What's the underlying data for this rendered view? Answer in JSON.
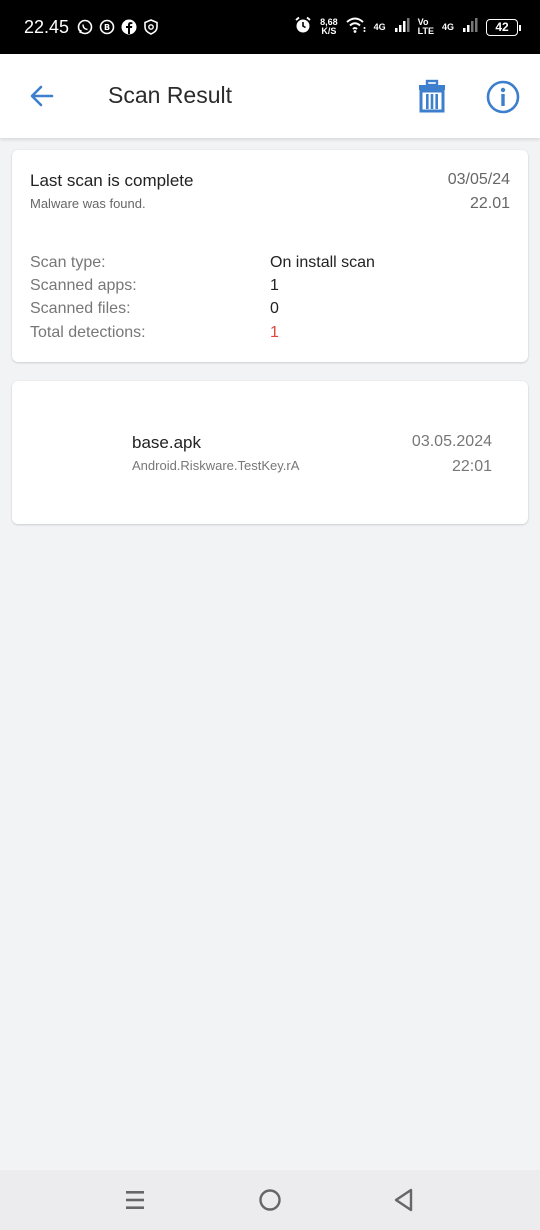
{
  "status_bar": {
    "time": "22.45",
    "net_speed": "8,68",
    "net_speed_unit": "K/S",
    "network_1": "4G",
    "volte": "Vo",
    "volte_sub": "LTE",
    "network_2": "4G",
    "battery": "42"
  },
  "app_bar": {
    "title": "Scan Result",
    "accent_color": "#3d7fcc"
  },
  "summary": {
    "title": "Last scan is complete",
    "subtitle": "Malware was found.",
    "date": "03/05/24",
    "time": "22.01",
    "stats": [
      {
        "label": "Scan type:",
        "value": "On install scan"
      },
      {
        "label": "Scanned apps:",
        "value": "1"
      },
      {
        "label": "Scanned files:",
        "value": "0"
      },
      {
        "label": "Total detections:",
        "value": "1"
      }
    ],
    "danger_color": "#e0463c"
  },
  "detections": [
    {
      "file": "base.apk",
      "threat": "Android.Riskware.TestKey.rA",
      "date": "03.05.2024",
      "time": "22:01"
    }
  ],
  "nav_bar": {
    "recents": "recents-icon",
    "home": "home-icon",
    "back": "back-triangle-icon"
  }
}
